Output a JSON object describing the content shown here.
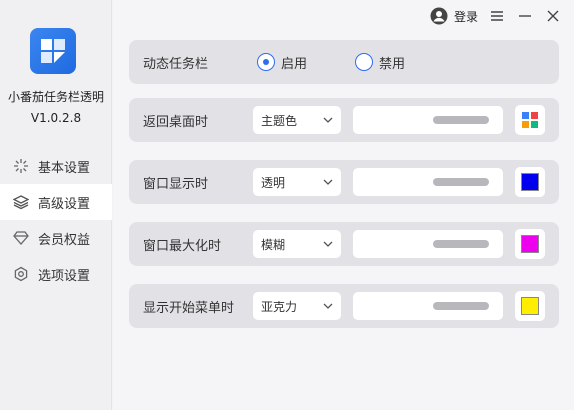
{
  "app": {
    "name": "小番茄任务栏透明",
    "version": "V1.0.2.8"
  },
  "titlebar": {
    "login_label": "登录"
  },
  "sidebar": {
    "items": [
      {
        "label": "基本设置",
        "icon": "sparkle-icon",
        "active": false
      },
      {
        "label": "高级设置",
        "icon": "layers-icon",
        "active": true
      },
      {
        "label": "会员权益",
        "icon": "diamond-icon",
        "active": false
      },
      {
        "label": "选项设置",
        "icon": "gear-icon",
        "active": false
      }
    ]
  },
  "dynamic_taskbar": {
    "label": "动态任务栏",
    "options": [
      {
        "label": "启用",
        "selected": true
      },
      {
        "label": "禁用",
        "selected": false
      }
    ]
  },
  "settings": [
    {
      "label": "返回桌面时",
      "mode": "主题色",
      "color": "palette"
    },
    {
      "label": "窗口显示时",
      "mode": "透明",
      "color": "#0000ee"
    },
    {
      "label": "窗口最大化时",
      "mode": "模糊",
      "color": "#ee00ee"
    },
    {
      "label": "显示开始菜单时",
      "mode": "亚克力",
      "color": "#ffee00"
    }
  ],
  "colors": {
    "accent": "#2d6df0",
    "card_bg": "#e2e2e6"
  }
}
